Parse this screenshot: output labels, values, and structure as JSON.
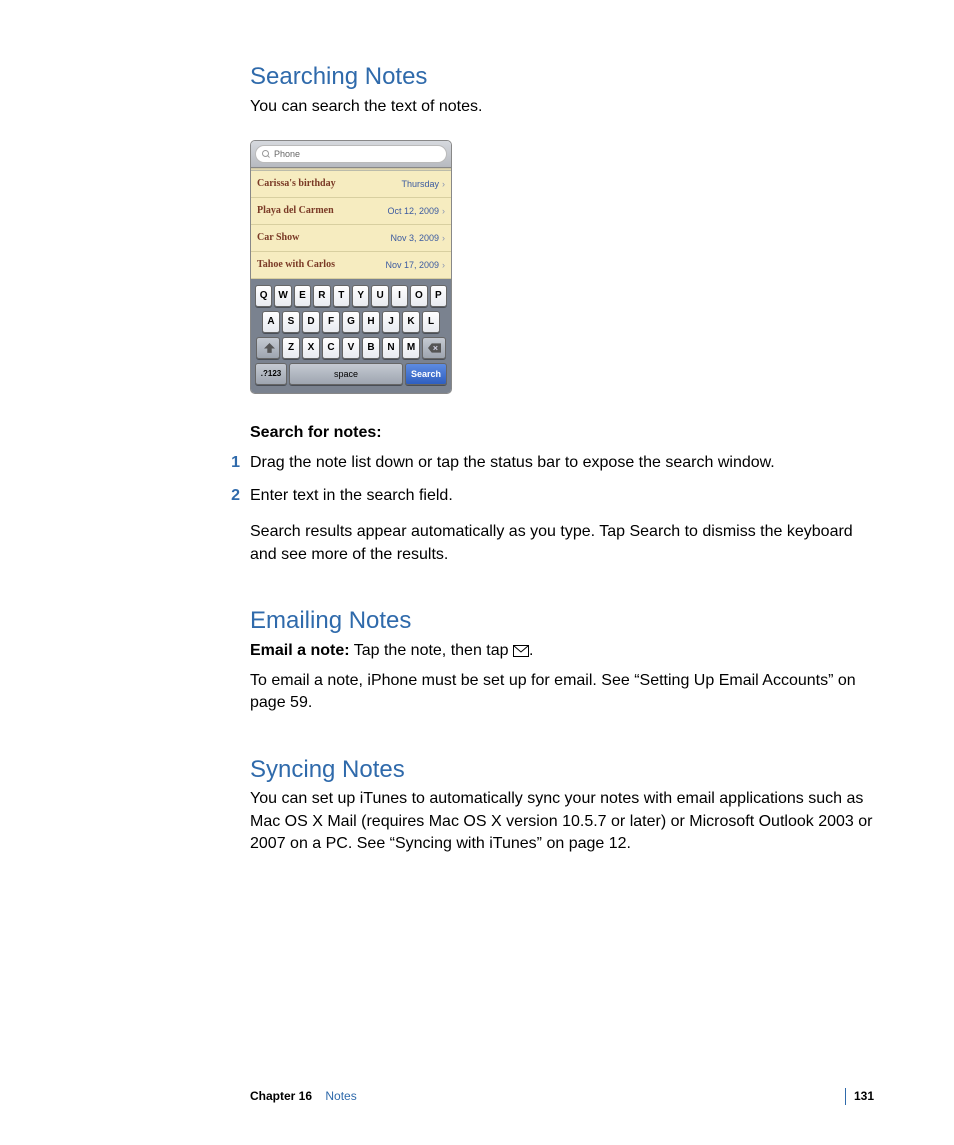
{
  "sections": {
    "searching": {
      "heading": "Searching Notes",
      "intro": "You can search the text of notes.",
      "instructions_label": "Search for notes:",
      "steps": [
        {
          "num": "1",
          "text": "Drag the note list down or tap the status bar to expose the search window."
        },
        {
          "num": "2",
          "text": "Enter text in the search field."
        }
      ],
      "after_steps": "Search results appear automatically as you type. Tap Search to dismiss the keyboard and see more of the results."
    },
    "emailing": {
      "heading": "Emailing Notes",
      "lead_label": "Email a note:",
      "lead_body_before": "  Tap the note, then tap ",
      "lead_body_after": ".",
      "body": "To email a note, iPhone must be set up for email. See “Setting Up Email Accounts” on page 59."
    },
    "syncing": {
      "heading": "Syncing Notes",
      "body": "You can set up iTunes to automatically sync your notes with email applications such as Mac OS X Mail (requires Mac OS X version 10.5.7 or later) or Microsoft Outlook 2003 or 2007 on a PC. See “Syncing with iTunes” on page 12."
    }
  },
  "device": {
    "search_placeholder": "Phone",
    "notes": [
      {
        "title": "Carissa's birthday",
        "date": "Thursday"
      },
      {
        "title": "Playa del Carmen",
        "date": "Oct 12, 2009"
      },
      {
        "title": "Car Show",
        "date": "Nov 3, 2009"
      },
      {
        "title": "Tahoe with Carlos",
        "date": "Nov 17, 2009"
      }
    ],
    "keys_row1": [
      "Q",
      "W",
      "E",
      "R",
      "T",
      "Y",
      "U",
      "I",
      "O",
      "P"
    ],
    "keys_row2": [
      "A",
      "S",
      "D",
      "F",
      "G",
      "H",
      "J",
      "K",
      "L"
    ],
    "keys_row3": [
      "Z",
      "X",
      "C",
      "V",
      "B",
      "N",
      "M"
    ],
    "key_numbers": ".?123",
    "key_space": "space",
    "key_search": "Search"
  },
  "footer": {
    "chapter_label": "Chapter 16",
    "chapter_name": "Notes",
    "page": "131"
  }
}
